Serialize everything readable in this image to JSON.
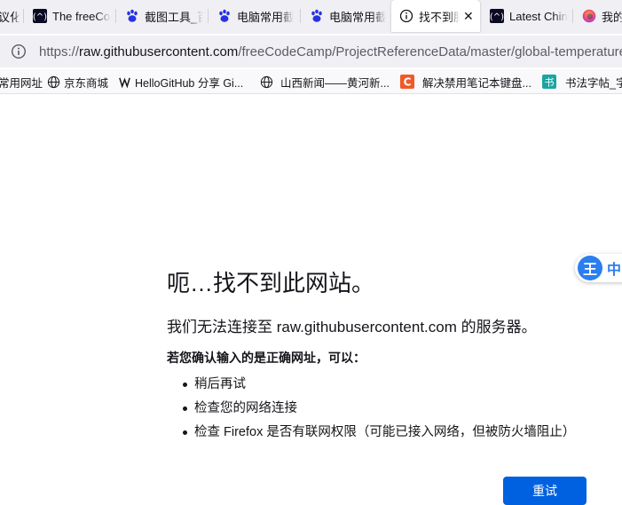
{
  "tabs": [
    {
      "label": "议化",
      "icon": "none"
    },
    {
      "label": "The freeCodeCamp",
      "icon": "freecodecamp-icon"
    },
    {
      "label": "截图工具_百度",
      "icon": "baidu-paw-icon"
    },
    {
      "label": "电脑常用截图",
      "icon": "baidu-paw-icon"
    },
    {
      "label": "电脑常用截图",
      "icon": "baidu-paw-icon"
    },
    {
      "label": "找不到服务器",
      "icon": "info-icon",
      "active": true
    },
    {
      "label": "Latest Chinese",
      "icon": "freecodecamp-icon"
    },
    {
      "label": "我的",
      "icon": "firefox-icon"
    }
  ],
  "urlbar": {
    "scheme": "https://",
    "host": "raw.githubusercontent.com",
    "path": "/freeCodeCamp/ProjectReferenceData/master/global-temperature"
  },
  "bookmarks": [
    {
      "label": "常用网址",
      "icon": "none"
    },
    {
      "label": "京东商城",
      "icon": "globe-icon"
    },
    {
      "label": "HelloGitHub 分享 Gi...",
      "icon": "hellogithub-icon"
    },
    {
      "label": "山西新闻——黄河新...",
      "icon": "globe-icon"
    },
    {
      "label": "解决禁用笔记本键盘...",
      "icon": "c-icon"
    },
    {
      "label": "书法字帖_字",
      "icon": "shu-icon"
    }
  ],
  "error": {
    "title": "呃…找不到此网站。",
    "description": "我们无法连接至 raw.githubusercontent.com 的服务器。",
    "subtitle": "若您确认输入的是正确网址，可以：",
    "suggestions": [
      "稍后再试",
      "检查您的网络连接",
      "检查 Firefox 是否有联网权限（可能已接入网络，但被防火墙阻止）"
    ],
    "retry_label": "重试"
  },
  "widget": {
    "badge": "王",
    "label": "中"
  },
  "colors": {
    "accent": "#0061e0",
    "chrome": "#f0f0f4",
    "text": "#15141a"
  }
}
